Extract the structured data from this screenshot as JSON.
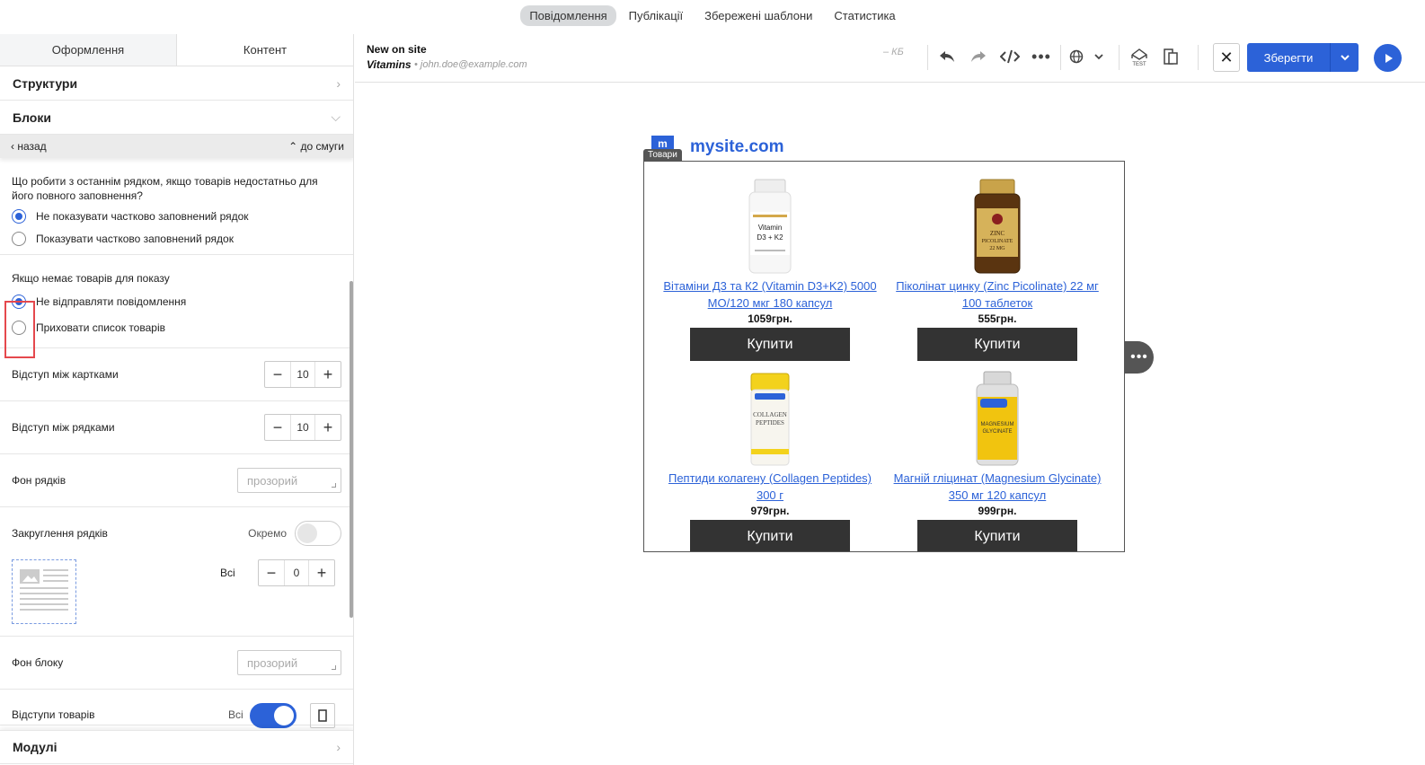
{
  "topnav": {
    "tabs": [
      "Повідомлення",
      "Публікації",
      "Збережені шаблони",
      "Статистика"
    ]
  },
  "left": {
    "tabs": [
      "Оформлення",
      "Контент"
    ],
    "structures": "Структури",
    "blocks": "Блоки",
    "back": "назад",
    "to_stripe": "до смуги",
    "last_row_question": "Що робити з останнім рядком, якщо товарів недостатньо для його повного заповнення?",
    "last_row_opt1": "Не показувати частково заповнений рядок",
    "last_row_opt2": "Показувати частково заповнений рядок",
    "no_items_title": "Якщо немає товарів для показу",
    "no_items_opt1": "Не відправляти повідомлення",
    "no_items_opt2": "Приховати список товарів",
    "card_gap_label": "Відступ між картками",
    "card_gap_value": "10",
    "row_gap_label": "Відступ між рядками",
    "row_gap_value": "10",
    "row_bg_label": "Фон рядків",
    "row_bg_placeholder": "прозорий",
    "row_radius_label": "Закруглення рядків",
    "row_radius_toggle_label": "Окремо",
    "all_label": "Всі",
    "radius_value": "0",
    "block_bg_label": "Фон блоку",
    "block_bg_placeholder": "прозорий",
    "item_padding_label": "Відступи товарів",
    "item_padding_all": "Всі",
    "modules": "Модулі"
  },
  "header": {
    "title": "New on site",
    "subject": "Vitamins",
    "sender": "• john.doe@example.com",
    "size": "– КБ",
    "save": "Зберегти"
  },
  "canvas": {
    "logo_letter": "m",
    "site_name": "mysite.com",
    "block_tag": "Товари",
    "products": [
      {
        "name": "Вітаміни Д3 та К2 (Vitamin D3+K2) 5000 МО/120 мкг 180 капсул",
        "price": "1059грн.",
        "buy": "Купити"
      },
      {
        "name": "Пiколiнат цинку (Zinc Picolinate) 22 мг 100 таблеток",
        "price": "555грн.",
        "buy": "Купити"
      },
      {
        "name": "Пептиди колагену (Collagen Peptides) 300 г",
        "price": "979грн.",
        "buy": "Купити"
      },
      {
        "name": "Магнiй глiцинат (Magnesium Glycinate) 350 мг 120 капсул",
        "price": "999грн.",
        "buy": "Купити"
      }
    ]
  },
  "colors": {
    "accent": "#2c62d8",
    "highlight": "#e5484d",
    "buy_button": "#333333"
  }
}
